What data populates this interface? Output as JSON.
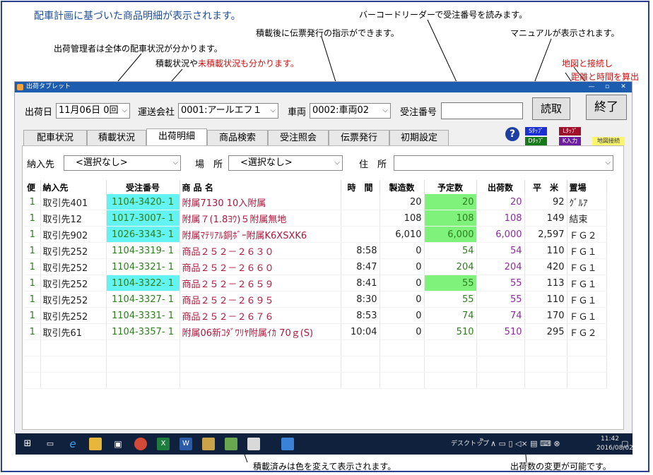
{
  "annotations": {
    "top_left": "配車計画に基づいた商品明細が表示されます。",
    "barcode": "バーコードリーダーで受注番号を読みます。",
    "slip": "積載後に伝票発行の指示ができます。",
    "manual": "マニュアルが表示されます。",
    "manager": "出荷管理者は全体の配車状況が分かります。",
    "loading_a": "積載状況や",
    "loading_b": "未積載状況も分かります。",
    "map1": "地図と接続し",
    "map2": "距離と時間を算出",
    "loaded_color": "積載済みは色を変えて表示されます。",
    "ship_change": "出荷数の変更が可能です。"
  },
  "window": {
    "title": "出荷タブレット",
    "min": "—",
    "max": "▫",
    "close": "✕"
  },
  "header": {
    "date_label": "出荷日",
    "date_value": "11月06日 0回",
    "company_label": "運送会社",
    "company_value": "0001:アールエフ１",
    "vehicle_label": "車両",
    "vehicle_value": "0002:車両02",
    "order_label": "受注番号",
    "order_value": "",
    "read_button": "読取",
    "exit_button": "終了"
  },
  "tabs": [
    "配車状況",
    "積載状況",
    "出荷明細",
    "商品検索",
    "受注照会",
    "伝票発行",
    "初期設定"
  ],
  "active_tab": 2,
  "mini_buttons": {
    "s": "Sﾀｯﾌﾟ",
    "l": "Lﾀｯﾌﾟ",
    "d": "Dﾀｯﾌﾟ",
    "k": "K入力",
    "map": "地図接続",
    "help": "?"
  },
  "filters": {
    "dest_label": "納入先",
    "dest_value": "<選択なし>",
    "place_label": "場　所",
    "place_value": "<選択なし>",
    "addr_label": "住　所",
    "addr_value": ""
  },
  "table": {
    "headers": [
      "便",
      "納入先",
      "受注番号",
      "商 品 名",
      "時　間",
      "製造数",
      "予定数",
      "出荷数",
      "平　米",
      "置場"
    ],
    "rows": [
      {
        "bin": "1",
        "dest": "取引先401",
        "order": "1104-3420- 1",
        "product": "附属7130 10入附属",
        "time": "",
        "made": "20",
        "plan": "20",
        "ship": "20",
        "area": "92",
        "loc": "ｸﾞﾙｱ",
        "hl_order": true,
        "hl_plan": true
      },
      {
        "bin": "1",
        "dest": "取引先12",
        "order": "1017-3007- 1",
        "product": "附属７(1.8ﾖｳ)５附属無地",
        "time": "",
        "made": "108",
        "plan": "108",
        "ship": "108",
        "area": "149",
        "loc": "結束",
        "hl_order": true,
        "hl_plan": true
      },
      {
        "bin": "1",
        "dest": "取引先902",
        "order": "1026-3343- 1",
        "product": "附属ﾏﾃﾘｱﾙ銅ﾎﾞｰ附属K6XSXK6",
        "time": "",
        "made": "6,010",
        "plan": "6,000",
        "ship": "6,000",
        "area": "2,597",
        "loc": "ＦＧ２",
        "hl_order": true,
        "hl_plan": true
      },
      {
        "bin": "1",
        "dest": "取引先252",
        "order": "1104-3319- 1",
        "product": "商品２５２－２６３０",
        "time": "8:58",
        "made": "0",
        "plan": "54",
        "ship": "54",
        "area": "110",
        "loc": "ＦＧ１",
        "hl_order": false,
        "hl_plan": false
      },
      {
        "bin": "1",
        "dest": "取引先252",
        "order": "1104-3321- 1",
        "product": "商品２５２－２６６０",
        "time": "8:47",
        "made": "0",
        "plan": "204",
        "ship": "204",
        "area": "420",
        "loc": "ＦＧ１",
        "hl_order": false,
        "hl_plan": false
      },
      {
        "bin": "1",
        "dest": "取引先252",
        "order": "1104-3322- 1",
        "product": "商品２５２－２６５９",
        "time": "8:41",
        "made": "0",
        "plan": "55",
        "ship": "55",
        "area": "113",
        "loc": "ＦＧ１",
        "hl_order": true,
        "hl_plan": true
      },
      {
        "bin": "1",
        "dest": "取引先252",
        "order": "1104-3327- 1",
        "product": "商品２５２－２６９５",
        "time": "8:30",
        "made": "0",
        "plan": "55",
        "ship": "55",
        "area": "110",
        "loc": "ＦＧ１",
        "hl_order": false,
        "hl_plan": false
      },
      {
        "bin": "1",
        "dest": "取引先252",
        "order": "1104-3331- 1",
        "product": "商品２５２－２６７６",
        "time": "8:53",
        "made": "0",
        "plan": "74",
        "ship": "74",
        "area": "170",
        "loc": "ＦＧ１",
        "hl_order": false,
        "hl_plan": false
      },
      {
        "bin": "1",
        "dest": "取引先61",
        "order": "1104-3357- 1",
        "product": "附属06新ｺﾀﾞﾜﾘﾔ附属ｲｶ 70ｇ(S)",
        "time": "10:04",
        "made": "0",
        "plan": "510",
        "ship": "510",
        "area": "295",
        "loc": "ＦＧ２",
        "hl_order": false,
        "hl_plan": false
      }
    ]
  },
  "taskbar": {
    "desktop": "デスクトップ",
    "time": "11:42",
    "date": "2016/08/02",
    "chevron": "»"
  },
  "colors": {
    "cyan": "#63f3f3",
    "green_hl": "#7ef27a",
    "green_text": "#2e7d1e",
    "red_text": "#b0163a",
    "purple_text": "#8e2aa0",
    "blue_title": "#1c5db0"
  }
}
